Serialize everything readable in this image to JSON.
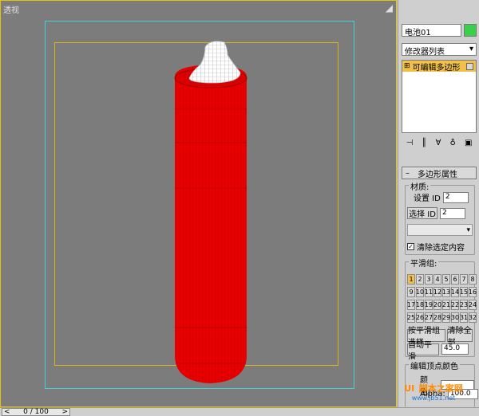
{
  "viewport": {
    "label": "透视"
  },
  "command_panel": {
    "object_name": "电池01",
    "object_color": "#3bd04a",
    "modifier_list": "修改器列表",
    "stack_item": "可编辑多边形",
    "rollout_title": "多边形属性",
    "material": {
      "title": "材质:",
      "set_id_label": "设置 ID",
      "set_id_value": "2",
      "select_id_label": "选择 ID",
      "select_id_value": "2",
      "clear_selection_label": "清除选定内容",
      "clear_selection_checked": true
    },
    "smoothing": {
      "title": "平滑组:",
      "groups": [
        "1",
        "2",
        "3",
        "4",
        "5",
        "6",
        "7",
        "8",
        "9",
        "10",
        "11",
        "12",
        "13",
        "14",
        "15",
        "16",
        "17",
        "18",
        "19",
        "20",
        "21",
        "22",
        "23",
        "24",
        "25",
        "26",
        "27",
        "28",
        "29",
        "30",
        "31",
        "32"
      ],
      "active_group": "1",
      "select_by_sg": "按平滑组选择",
      "clear_all": "清除全部",
      "auto_smooth": "自动平滑",
      "auto_smooth_value": "45.0"
    },
    "vertex_colors": {
      "title": "编辑顶点颜色",
      "color_label": "颜色:",
      "alpha_label": "Alpha:",
      "alpha_value": "100.0"
    }
  },
  "timeline": {
    "position": "0 / 100"
  },
  "watermark": {
    "top": "UI",
    "bottom": "脚本之家网",
    "sub": "www.jb51.net"
  },
  "colors": {
    "object_red": "#ee0000",
    "cap_white": "#ffffff",
    "accent_yellow": "#f1c04a"
  }
}
